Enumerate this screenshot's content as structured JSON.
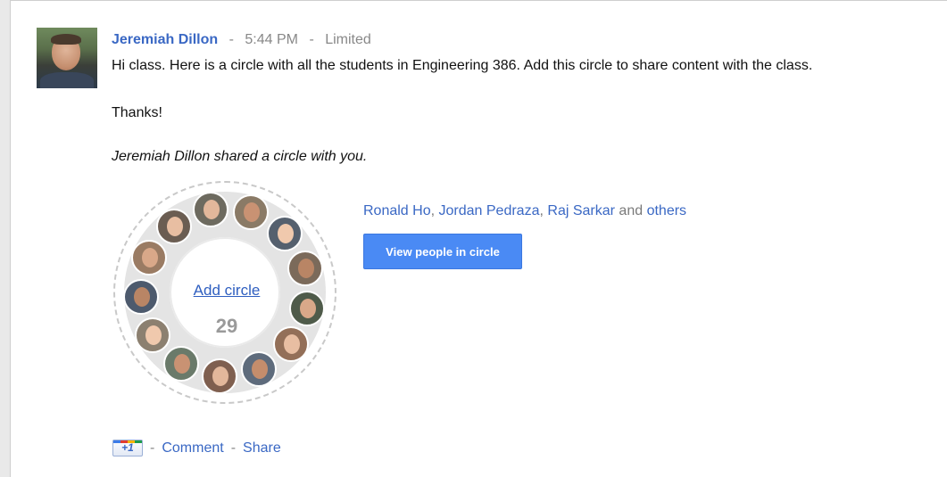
{
  "post": {
    "author": "Jeremiah Dillon",
    "time": "5:44 PM",
    "visibility": "Limited",
    "separator": "-",
    "message": "Hi class. Here is a circle with all the students in Engineering 386. Add this circle to share content with the class.",
    "thanks": "Thanks!",
    "shared_note": "Jeremiah Dillon shared a circle with you."
  },
  "circle": {
    "add_label": "Add circle",
    "count": "29",
    "member_avatar_count": 13
  },
  "people": {
    "names": [
      "Ronald Ho",
      "Jordan Pedraza",
      "Raj Sarkar"
    ],
    "comma": ",",
    "and": "and",
    "others": "others",
    "view_button": "View people in circle"
  },
  "actions": {
    "plus_one": "+1",
    "separator": "-",
    "comment": "Comment",
    "share": "Share"
  },
  "colors": {
    "link": "#3a68c4",
    "button": "#4a8af4",
    "meta_grey": "#888888"
  }
}
